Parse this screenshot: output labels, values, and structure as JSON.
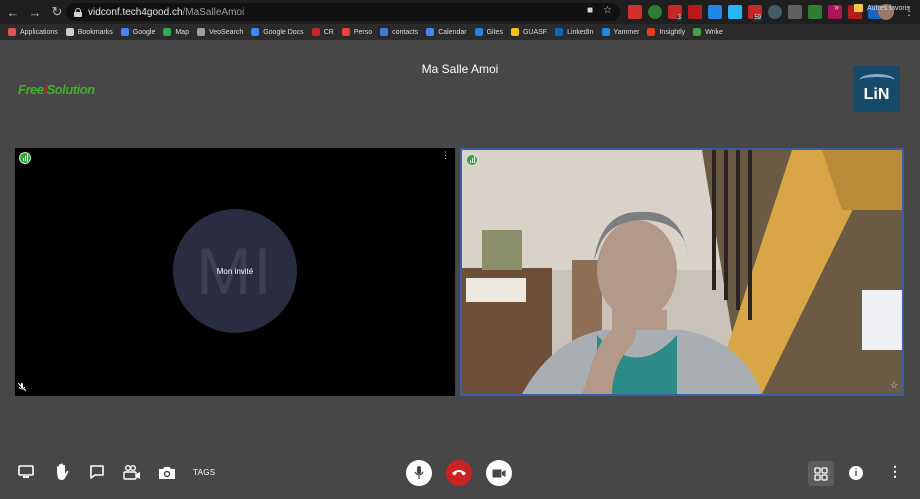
{
  "browser": {
    "url_domain": "vidconf.tech4good.ch",
    "url_path": "/MaSalleAmoi",
    "ext_badges": [
      "3",
      "59"
    ]
  },
  "bookmarks": {
    "items": [
      {
        "label": "Applications",
        "color": "#d9534f"
      },
      {
        "label": "Bookmarks",
        "color": "#cccccc"
      },
      {
        "label": "Google",
        "color": "#4285f4"
      },
      {
        "label": "Map",
        "color": "#34a853"
      },
      {
        "label": "VeoSearch",
        "color": "#9e9e9e"
      },
      {
        "label": "Google Docs",
        "color": "#4285f4"
      },
      {
        "label": "CR",
        "color": "#c62828"
      },
      {
        "label": "Perso",
        "color": "#ea4335"
      },
      {
        "label": "contacts",
        "color": "#3f7fd1"
      },
      {
        "label": "Calendar",
        "color": "#4285f4"
      },
      {
        "label": "Gites",
        "color": "#1e88e5"
      },
      {
        "label": "GUASF",
        "color": "#f4c20d"
      },
      {
        "label": "LinkedIn",
        "color": "#0a66c2"
      },
      {
        "label": "Yammer",
        "color": "#1e88e5"
      },
      {
        "label": "Insightly",
        "color": "#e2401c"
      },
      {
        "label": "Wrike",
        "color": "#43a047"
      }
    ],
    "more": "»",
    "other": "Autres favoris"
  },
  "room": {
    "title": "Ma Salle Amoi"
  },
  "logos": {
    "left_part1": "Free",
    "left_part2": "Solution",
    "right_initials": "LiN"
  },
  "participants": {
    "guest": {
      "initials": "MI",
      "name": "Mon invité"
    }
  },
  "toolbar": {
    "tags_label": "TAGS"
  },
  "colors": {
    "accent_border": "#3a5da8",
    "hangup": "#cc2222",
    "signal_good": "#2fa33a"
  }
}
